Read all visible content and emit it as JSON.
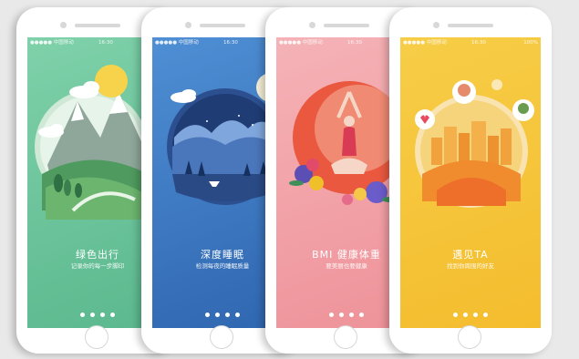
{
  "screens": [
    {
      "carrier": "●●●●● 中国移动 ",
      "time": "16:30",
      "right": "",
      "title": "绿色出行",
      "subtitle": "记录你的每一步脚印",
      "colors": {
        "bg": "#6fc79f",
        "accent": "#4aa57b"
      }
    },
    {
      "carrier": "●●●●● 中国移动 ",
      "time": "16:30",
      "right": "",
      "title": "深度睡眠",
      "subtitle": "检测每夜的睡眠质量",
      "colors": {
        "bg": "#3f7dc4",
        "accent": "#2a5a9e"
      }
    },
    {
      "carrier": "●●●●● 中国移动 ",
      "time": "16:30",
      "right": "",
      "title": "BMI 健康体重",
      "subtitle": "要美丽也要健康",
      "colors": {
        "bg": "#f2a0a6",
        "accent": "#e96a4f"
      }
    },
    {
      "carrier": "●●●●● 中国移动 ",
      "time": "16:30",
      "right": "100%",
      "title": "遇见TA",
      "subtitle": "找到你周围的好友",
      "colors": {
        "bg": "#f6c83b",
        "accent": "#f19a2f"
      }
    }
  ]
}
